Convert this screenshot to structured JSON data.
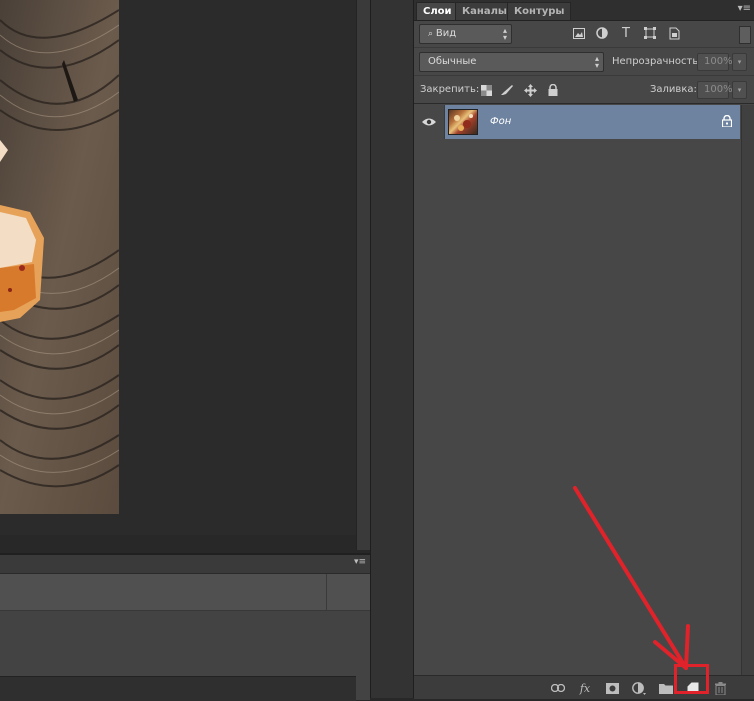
{
  "layers_panel": {
    "tabs": [
      {
        "label": "Слои",
        "active": true
      },
      {
        "label": "Каналы",
        "active": false
      },
      {
        "label": "Контуры",
        "active": false
      }
    ],
    "filter": {
      "value": "Вид"
    },
    "blend_mode": {
      "value": "Обычные"
    },
    "opacity": {
      "label": "Непрозрачность:",
      "value": "100%"
    },
    "lock": {
      "label": "Закрепить:"
    },
    "fill": {
      "label": "Заливка:",
      "value": "100%"
    },
    "layers": [
      {
        "name": "Фон",
        "visible": true,
        "locked": true,
        "selected": true
      }
    ]
  },
  "bottom_toolbar": {
    "icons": [
      "link-icon",
      "fx-icon",
      "mask-icon",
      "adjustment-icon",
      "folder-icon",
      "new-layer-icon",
      "trash-icon"
    ],
    "fx_label": "fx"
  },
  "annotation": {
    "color": "#e0222a",
    "target": "new-layer-button"
  },
  "colors": {
    "selection": "#6e83a0",
    "panel": "#474747",
    "annotation": "#e0222a"
  }
}
